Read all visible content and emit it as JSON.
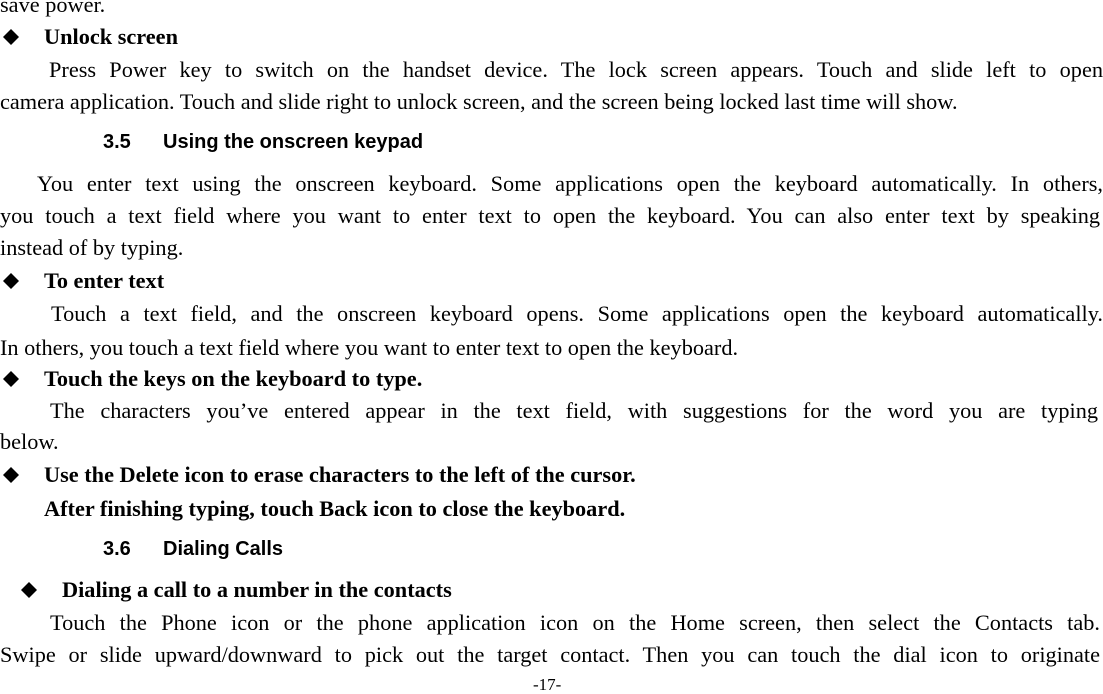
{
  "page": {
    "lines": {
      "l0": "save power.",
      "unlock_title": "Unlock screen",
      "l2": "Press Power key to switch on the handset device. The lock screen appears. Touch and slide left to open",
      "l3": "camera application. Touch and slide right to unlock screen, and the screen being locked last time will show.",
      "keypad_text1": "You enter text using the onscreen keyboard. Some applications open the keyboard automatically. In others,",
      "keypad_text2": "you touch a text field where you want to enter text to open the keyboard. You can also enter text by speaking",
      "keypad_text3": "instead of by typing.",
      "enter_title": "To enter text",
      "enter_text1": "Touch a text field, and the onscreen keyboard opens. Some applications open the keyboard automatically.",
      "enter_text2": "In others, you touch a text field where you want to enter text to open the keyboard.",
      "keys_title": "Touch the keys on the keyboard to type.",
      "keys_text1": "The characters you’ve entered appear in the text field, with suggestions for the word you are typing",
      "keys_text2": "below.",
      "delete_title": "Use the Delete icon to erase characters to the left of the cursor.",
      "back_title": "After finishing typing, touch Back icon to close the keyboard.",
      "dial_title": "Dialing a call to a number in the contacts",
      "dial_text1": "Touch the Phone icon or the phone application icon on the Home screen, then select the Contacts tab.",
      "dial_text2": "Swipe or slide upward/downward to pick out the target contact. Then you can touch the dial icon to originate"
    },
    "sections": {
      "s35": {
        "number": "3.5",
        "title": "Using the onscreen keypad"
      },
      "s36": {
        "number": "3.6",
        "title": "Dialing Calls"
      }
    },
    "page_number": "-17-",
    "bullet_icon": "diamond-bullet"
  }
}
